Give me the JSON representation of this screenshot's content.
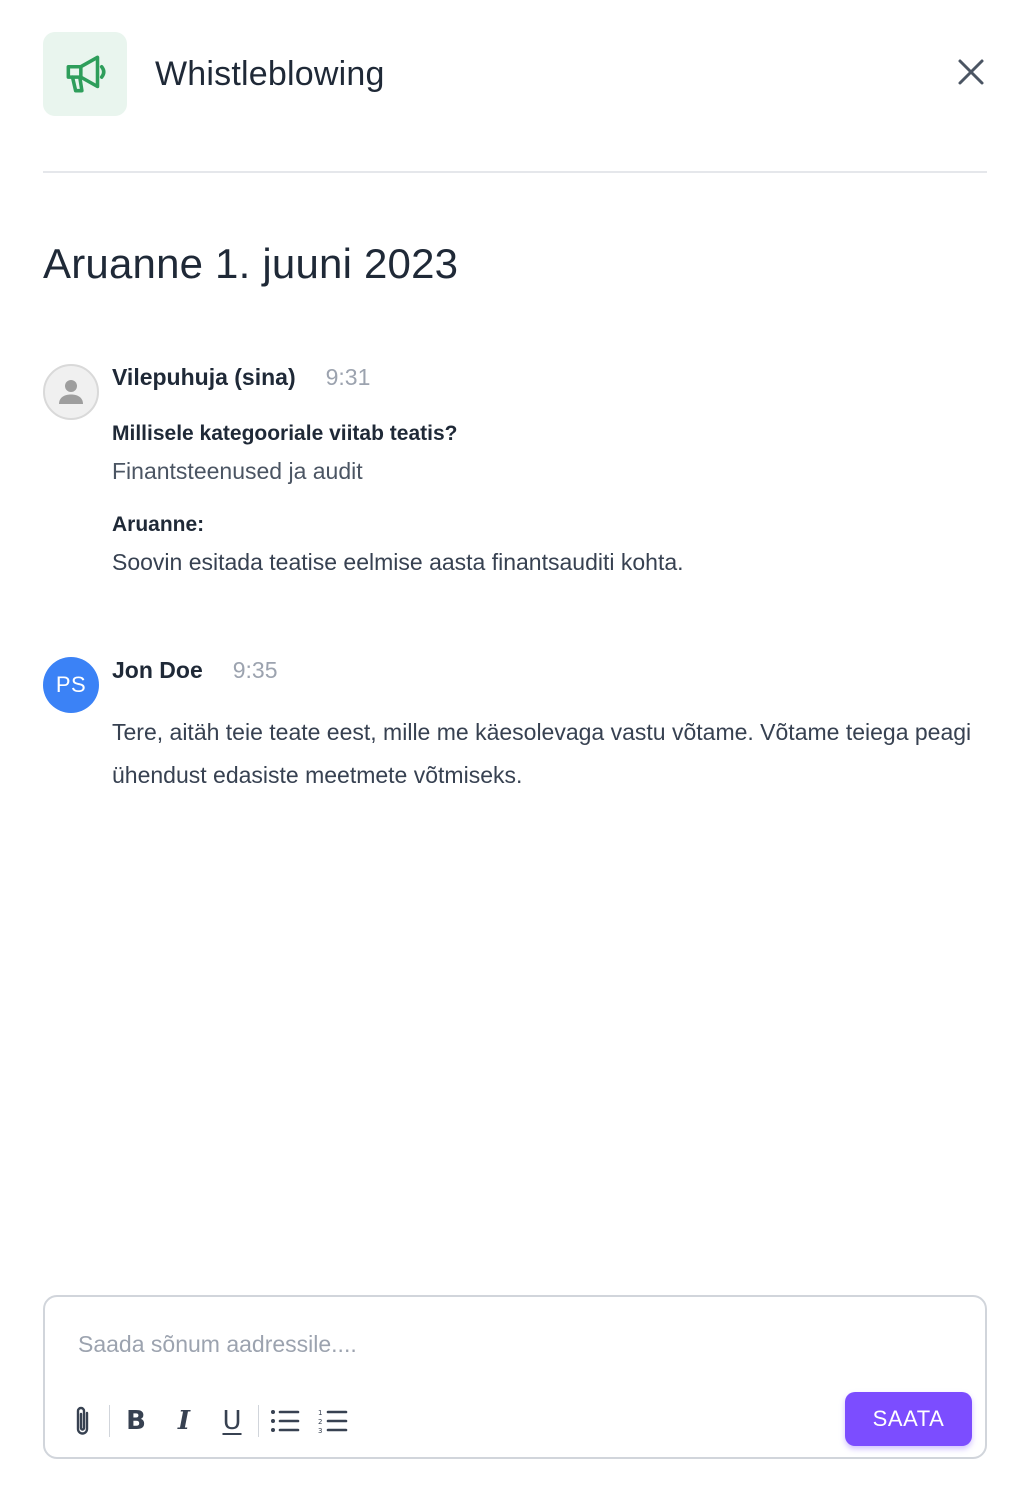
{
  "header": {
    "title": "Whistleblowing",
    "app_icon": "megaphone-icon",
    "close_icon": "close-icon"
  },
  "report": {
    "title": "Aruanne 1. juuni 2023"
  },
  "messages": [
    {
      "sender": "Vilepuhuja (sina)",
      "time": "9:31",
      "avatar_icon": "user-icon",
      "fields": [
        {
          "label": "Millisele kategooriale viitab teatis?",
          "value": "Finantsteenused ja audit"
        },
        {
          "label": "Aruanne:",
          "value": "Soovin esitada teatise eelmise aasta finantsauditi kohta."
        }
      ]
    },
    {
      "sender": "Jon Doe",
      "time": "9:35",
      "avatar_initials": "PS",
      "text": "Tere, aitäh teie teate eest, mille me käesolevaga vastu võtame. Võtame teiega peagi ühendust edasiste meetmete võtmiseks."
    }
  ],
  "composer": {
    "placeholder": "Saada sõnum aadressile....",
    "value": "",
    "tools": {
      "attach": "paperclip-icon",
      "bold": "B",
      "italic": "I",
      "underline": "U",
      "bullet_list": "bullet-list-icon",
      "numbered_list": "numbered-list-icon"
    },
    "send_label": "SAATA"
  },
  "colors": {
    "accent": "#7c4dff",
    "brand_green": "#2e9e5b",
    "icon_bg": "#e9f5ee",
    "avatar_blue": "#3b82f6"
  }
}
